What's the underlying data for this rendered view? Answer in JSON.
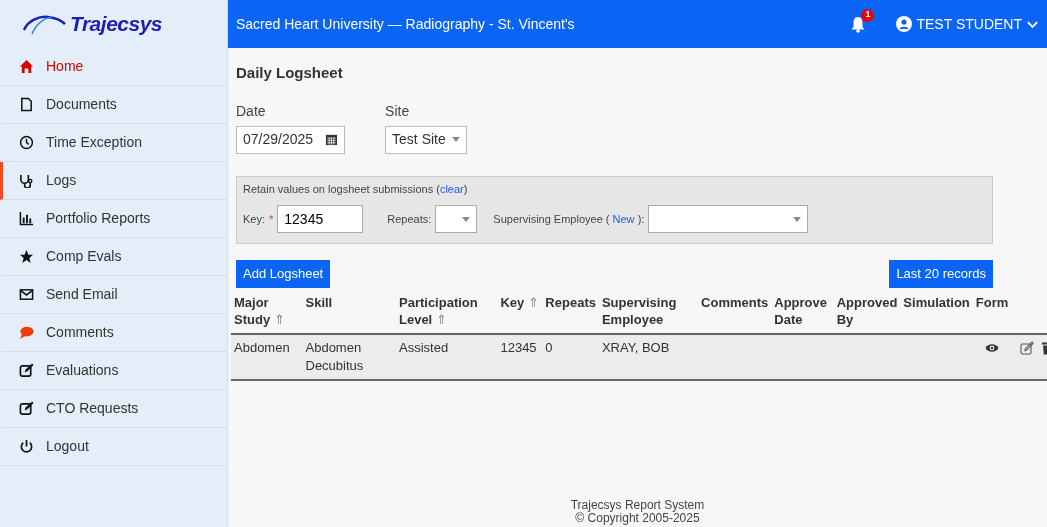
{
  "logo": {
    "text": "Trajecsys"
  },
  "sidebar": {
    "items": [
      {
        "label": "Home",
        "kind": "home",
        "color": "#d90000",
        "highlighted": true,
        "selected": false
      },
      {
        "label": "Documents",
        "kind": "file",
        "color": "#111111",
        "highlighted": false,
        "selected": false
      },
      {
        "label": "Time Exception",
        "kind": "clock",
        "color": "#111111",
        "highlighted": false,
        "selected": false
      },
      {
        "label": "Logs",
        "kind": "stethoscope",
        "color": "#111111",
        "highlighted": false,
        "selected": true
      },
      {
        "label": "Portfolio Reports",
        "kind": "chart",
        "color": "#111111",
        "highlighted": false,
        "selected": false
      },
      {
        "label": "Comp Evals",
        "kind": "star",
        "color": "#111111",
        "highlighted": false,
        "selected": false
      },
      {
        "label": "Send Email",
        "kind": "envelope",
        "color": "#111111",
        "highlighted": false,
        "selected": false
      },
      {
        "label": "Comments",
        "kind": "speech",
        "color": "#f03c0a",
        "highlighted": false,
        "selected": false
      },
      {
        "label": "Evaluations",
        "kind": "edit",
        "color": "#111111",
        "highlighted": false,
        "selected": false
      },
      {
        "label": "CTO Requests",
        "kind": "edit",
        "color": "#111111",
        "highlighted": false,
        "selected": false
      },
      {
        "label": "Logout",
        "kind": "power",
        "color": "#111111",
        "highlighted": false,
        "selected": false
      }
    ]
  },
  "topbar": {
    "title": "Sacred Heart University — Radiography - St. Vincent's",
    "notification_count": "1",
    "user": "TEST STUDENT"
  },
  "page_title": "Daily Logsheet",
  "date": {
    "label": "Date",
    "value": "07/29/2025"
  },
  "site": {
    "label": "Site",
    "value": "Test Site"
  },
  "retain": {
    "text": "Retain values on logsheet submissions (",
    "link": "clear",
    "after": ")",
    "key": {
      "label": "Key:",
      "required": "*",
      "value": "12345"
    },
    "repeats": {
      "label": "Repeats:"
    },
    "supervisor": {
      "label_before": "Supervising Employee (",
      "link": "New",
      "label_after": "):"
    }
  },
  "buttons": {
    "add": "Add Logsheet",
    "last": "Last 20 records"
  },
  "table": {
    "columns": [
      {
        "lines": [
          "Major",
          "Study"
        ],
        "sort": "⇑"
      },
      {
        "lines": [
          "Skill"
        ]
      },
      {
        "lines": [
          "Participation",
          "Level"
        ],
        "sort": "⇑"
      },
      {
        "lines": [
          "Key"
        ],
        "sort": "⇑"
      },
      {
        "lines": [
          "Repeats"
        ]
      },
      {
        "lines": [
          "Supervising",
          "Employee"
        ]
      },
      {
        "lines": [
          "Comments"
        ]
      },
      {
        "lines": [
          "Approve",
          "Date"
        ]
      },
      {
        "lines": [
          "Approved",
          "By"
        ]
      },
      {
        "lines": [
          "Simulation"
        ]
      },
      {
        "lines": [
          "Form"
        ]
      }
    ],
    "rows": [
      {
        "cells": [
          "Abdomen",
          "Abdomen Decubitus",
          "Assisted",
          "12345",
          "0",
          "XRAY, BOB",
          null,
          null,
          null,
          null
        ]
      }
    ]
  },
  "footer": {
    "line_1": "Trajecsys Report System",
    "line_2": "© Copyright 2005-2025"
  }
}
